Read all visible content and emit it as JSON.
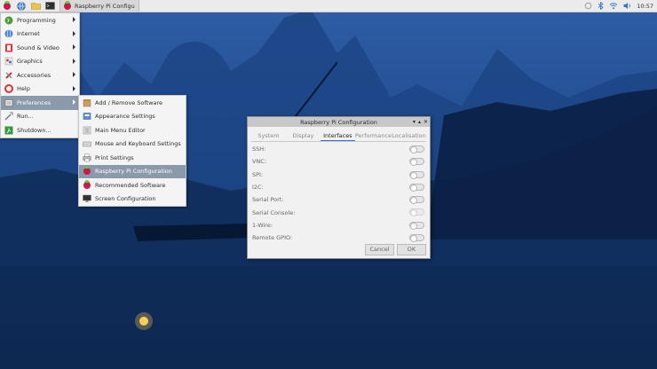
{
  "taskbar": {
    "window_title": "Raspberry Pi Configu",
    "clock": "10:57",
    "icons": [
      "raspberry-menu-icon",
      "globe-icon",
      "folder-icon",
      "terminal-icon",
      "sync-icon",
      "bluetooth-icon",
      "wifi-icon",
      "speaker-icon"
    ]
  },
  "main_menu": {
    "items": [
      {
        "label": "Programming",
        "has_submenu": true
      },
      {
        "label": "Internet",
        "has_submenu": true
      },
      {
        "label": "Sound & Video",
        "has_submenu": true
      },
      {
        "label": "Graphics",
        "has_submenu": true
      },
      {
        "label": "Accessories",
        "has_submenu": true
      },
      {
        "label": "Help",
        "has_submenu": true
      },
      {
        "label": "Preferences",
        "has_submenu": true,
        "selected": true
      },
      {
        "label": "Run...",
        "has_submenu": false
      },
      {
        "label": "Shutdown...",
        "has_submenu": false
      }
    ]
  },
  "preferences_menu": {
    "items": [
      {
        "label": "Add / Remove Software"
      },
      {
        "label": "Appearance Settings"
      },
      {
        "label": "Main Menu Editor"
      },
      {
        "label": "Mouse and Keyboard Settings"
      },
      {
        "label": "Print Settings"
      },
      {
        "label": "Raspberry Pi Configuration",
        "selected": true
      },
      {
        "label": "Recommended Software"
      },
      {
        "label": "Screen Configuration"
      }
    ]
  },
  "dialog": {
    "title": "Raspberry Pi Configuration",
    "tabs": [
      {
        "label": "System"
      },
      {
        "label": "Display"
      },
      {
        "label": "Interfaces",
        "active": true
      },
      {
        "label": "Performance"
      },
      {
        "label": "Localisation"
      }
    ],
    "rows": [
      {
        "label": "SSH:",
        "state": "off"
      },
      {
        "label": "VNC:",
        "state": "off"
      },
      {
        "label": "SPI:",
        "state": "off"
      },
      {
        "label": "I2C:",
        "state": "off"
      },
      {
        "label": "Serial Port:",
        "state": "off"
      },
      {
        "label": "Serial Console:",
        "state": "off",
        "disabled": true
      },
      {
        "label": "1-Wire:",
        "state": "off"
      },
      {
        "label": "Remote GPIO:",
        "state": "off"
      }
    ],
    "cancel_label": "Cancel",
    "ok_label": "OK"
  },
  "colors": {
    "menu_highlight": "#8b9aab",
    "desktop": "#234d92",
    "tab_accent": "#3b6fc6"
  }
}
